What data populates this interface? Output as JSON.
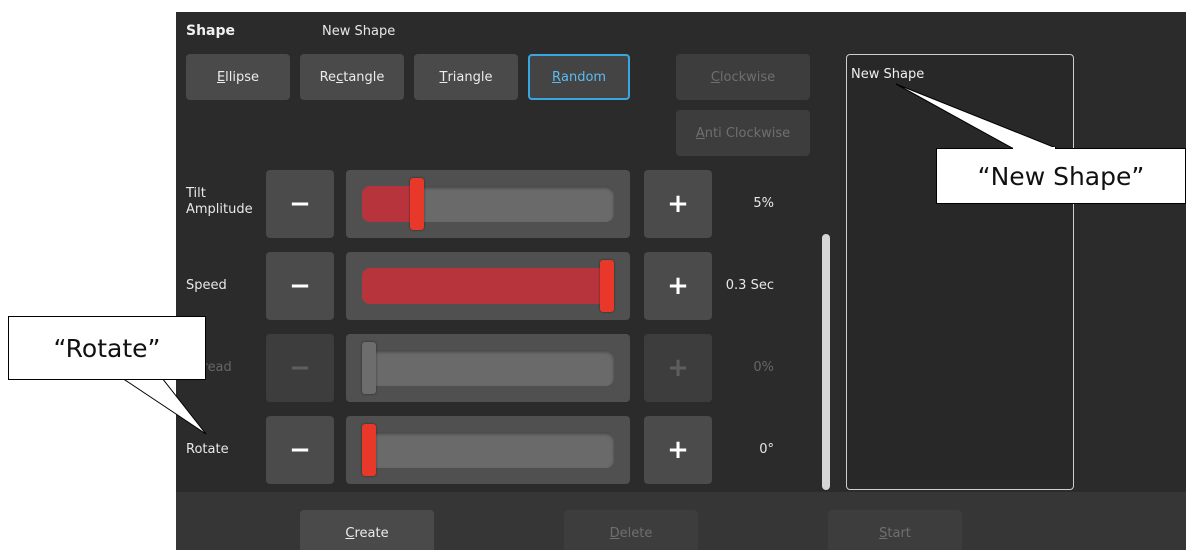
{
  "header": {
    "title": "Shape",
    "name": "New Shape"
  },
  "shape_buttons": [
    {
      "pre": "",
      "key": "E",
      "post": "llipse"
    },
    {
      "pre": "Re",
      "key": "c",
      "post": "tangle"
    },
    {
      "pre": "",
      "key": "T",
      "post": "riangle"
    },
    {
      "pre": "",
      "key": "R",
      "post": "andom"
    }
  ],
  "direction_buttons": [
    {
      "pre": "",
      "key": "C",
      "post": "lockwise"
    },
    {
      "pre": "",
      "key": "A",
      "post": "nti Clockwise"
    }
  ],
  "sliders": [
    {
      "label": "Tilt\nAmplitude",
      "minus": "−",
      "plus": "+",
      "value": "5%",
      "level": 0.2,
      "enabled": true
    },
    {
      "label": "Speed",
      "minus": "−",
      "plus": "+",
      "value": "0.3 Sec",
      "level": 1.0,
      "enabled": true
    },
    {
      "label": "Spread",
      "minus": "−",
      "plus": "+",
      "value": "0%",
      "level": 0.0,
      "enabled": false
    },
    {
      "label": "Rotate",
      "minus": "−",
      "plus": "+",
      "value": "0°",
      "level": 0.0,
      "enabled": true
    }
  ],
  "shape_list": {
    "items": [
      "New Shape"
    ]
  },
  "footer_buttons": [
    {
      "pre": "",
      "key": "C",
      "post": "reate"
    },
    {
      "pre": "",
      "key": "D",
      "post": "elete"
    },
    {
      "pre": "",
      "key": "S",
      "post": "tart"
    }
  ],
  "callouts": {
    "rotate": "“Rotate”",
    "new_shape": "“New Shape”"
  },
  "colors": {
    "accent": "#38a6e3",
    "slider_thumb": "#e8382a",
    "slider_fill": "#b8343c"
  }
}
